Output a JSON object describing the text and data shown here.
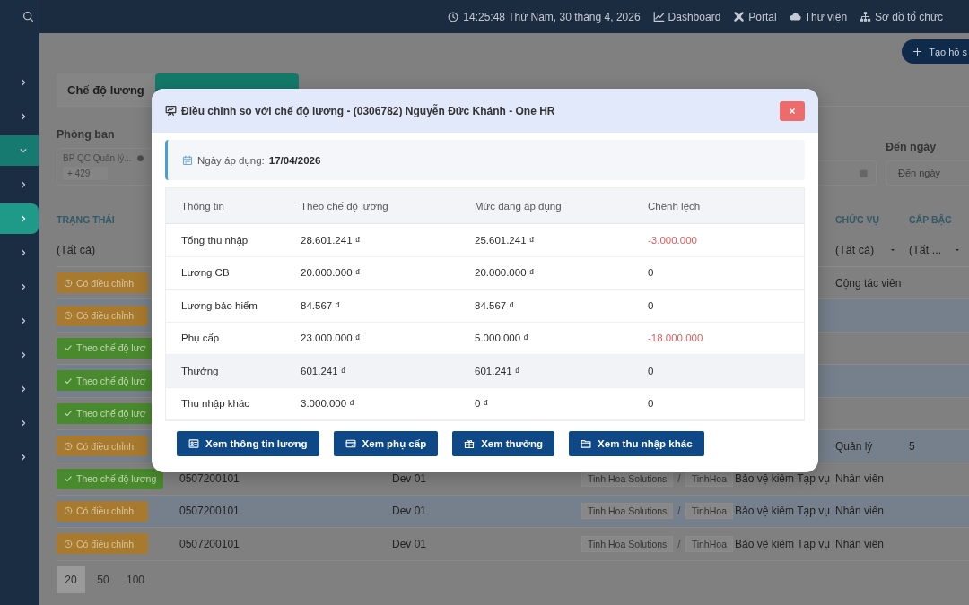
{
  "topbar": {
    "clock": "14:25:48 Thứ Năm, 30 tháng 4, 2026",
    "links": [
      "Dashboard",
      "Portal",
      "Thư viện",
      "Sơ đồ tổ chức"
    ]
  },
  "sidebar": {
    "items": [
      {
        "expanded": false,
        "selected": false
      },
      {
        "expanded": false,
        "selected": false
      },
      {
        "expanded": true,
        "selected": false
      },
      {
        "expanded": false,
        "selected": false
      },
      {
        "expanded": false,
        "selected": true
      },
      {
        "expanded": false,
        "selected": false
      },
      {
        "expanded": false,
        "selected": false
      },
      {
        "expanded": false,
        "selected": false
      },
      {
        "expanded": false,
        "selected": false
      },
      {
        "expanded": false,
        "selected": false
      },
      {
        "expanded": false,
        "selected": false
      },
      {
        "expanded": false,
        "selected": false
      }
    ]
  },
  "page": {
    "create_button": "Tạo hồ s",
    "tabs": [
      {
        "label": "Chế độ lương",
        "selected": false
      },
      {
        "selected": true
      }
    ],
    "filters": {
      "department": {
        "label": "Phòng ban",
        "tag": "BP QC Quản lý...",
        "more": "+ 429"
      },
      "to_date": {
        "label": "Đến ngày",
        "placeholder": "Đến ngày"
      }
    },
    "table": {
      "columns": {
        "status": "TRẠNG THÁI",
        "chuc_vu": "CHỨC VỤ",
        "cap_bac": "CẤP BẬC"
      },
      "filter_row": {
        "status": "(Tất cả)",
        "chuc_vu": "(Tất cả)",
        "cap_bac": "(Tất ..."
      },
      "rows": [
        {
          "status": {
            "kind": "adjusted",
            "label": "Có điều chỉnh"
          },
          "chuc_vu": "Cộng tác viên"
        },
        {
          "status": {
            "kind": "adjusted",
            "label": "Có điều chỉnh"
          }
        },
        {
          "status": {
            "kind": "standard",
            "label": "Theo chế độ lươ"
          }
        },
        {
          "status": {
            "kind": "standard",
            "label": "Theo chế độ lươ"
          }
        },
        {
          "status": {
            "kind": "standard",
            "label": "Theo chế độ lươ"
          }
        },
        {
          "status": {
            "kind": "adjusted",
            "label": "Có điều chỉnh"
          },
          "chuc_vu": "Quản lý",
          "cap_bac": "5"
        },
        {
          "status": {
            "kind": "standard",
            "label": "Theo chế độ lương"
          },
          "column_2": "0507200101",
          "column_3": "Dev 01",
          "column_4": {
            "parts": [
              "Tinh Hoa Solutions",
              "TinhHoa"
            ],
            "separator": "/"
          },
          "column_5": "Bảo vệ kiêm Tạp vụ",
          "chuc_vu": "Nhân viên"
        },
        {
          "status": {
            "kind": "adjusted",
            "label": "Có điều chỉnh"
          },
          "column_2": "0507200101",
          "column_3": "Dev 01",
          "column_4": {
            "parts": [
              "Tinh Hoa Solutions",
              "TinhHoa"
            ],
            "separator": "/"
          },
          "column_5": "Bảo vệ kiêm Tạp vụ",
          "chuc_vu": "Nhân viên"
        },
        {
          "status": {
            "kind": "adjusted",
            "label": "Có điều chỉnh"
          },
          "column_2": "0507200101",
          "column_3": "Dev 01",
          "column_4": {
            "parts": [
              "Tinh Hoa Solutions",
              "TinhHoa"
            ],
            "separator": "/"
          },
          "column_5": "Bảo vệ kiêm Tạp vụ",
          "chuc_vu": "Nhân viên"
        }
      ]
    },
    "page_sizes": [
      {
        "label": "20",
        "selected": true
      },
      {
        "label": "50",
        "selected": false
      },
      {
        "label": "100",
        "selected": false
      }
    ]
  },
  "modal": {
    "title": "Điều chỉnh so với chế độ lương - (0306782) Nguyễn Đức Khánh - One HR",
    "effective_date": {
      "label": "Ngày áp dụng:",
      "value": "17/04/2026"
    },
    "table": {
      "columns": [
        "Thông tin",
        "Theo chế độ lương",
        "Mức đang áp dụng",
        "Chênh lệch"
      ],
      "rows": [
        {
          "item": "Tổng thu nhập",
          "standard": "28.601.241 ₫",
          "current": "25.601.241 ₫",
          "difference": "-3.000.000",
          "negative": true,
          "highlighted": false
        },
        {
          "item": "Lương CB",
          "standard": "20.000.000 ₫",
          "current": "20.000.000 ₫",
          "difference": "0",
          "negative": false,
          "highlighted": false
        },
        {
          "item": "Lương bảo hiểm",
          "standard": "84.567 ₫",
          "current": "84.567 ₫",
          "difference": "0",
          "negative": false,
          "highlighted": false
        },
        {
          "item": "Phụ cấp",
          "standard": "23.000.000 ₫",
          "current": "5.000.000 ₫",
          "difference": "-18.000.000",
          "negative": true,
          "highlighted": false
        },
        {
          "item": "Thưởng",
          "standard": "601.241 ₫",
          "current": "601.241 ₫",
          "difference": "0",
          "negative": false,
          "highlighted": true
        },
        {
          "item": "Thu nhập khác",
          "standard": "3.000.000 ₫",
          "current": "0 ₫",
          "difference": "0",
          "negative": false,
          "highlighted": false
        }
      ]
    },
    "buttons": [
      "Xem thông tin lương",
      "Xem phụ cấp",
      "Xem thưởng",
      "Xem thu nhập khác"
    ]
  }
}
